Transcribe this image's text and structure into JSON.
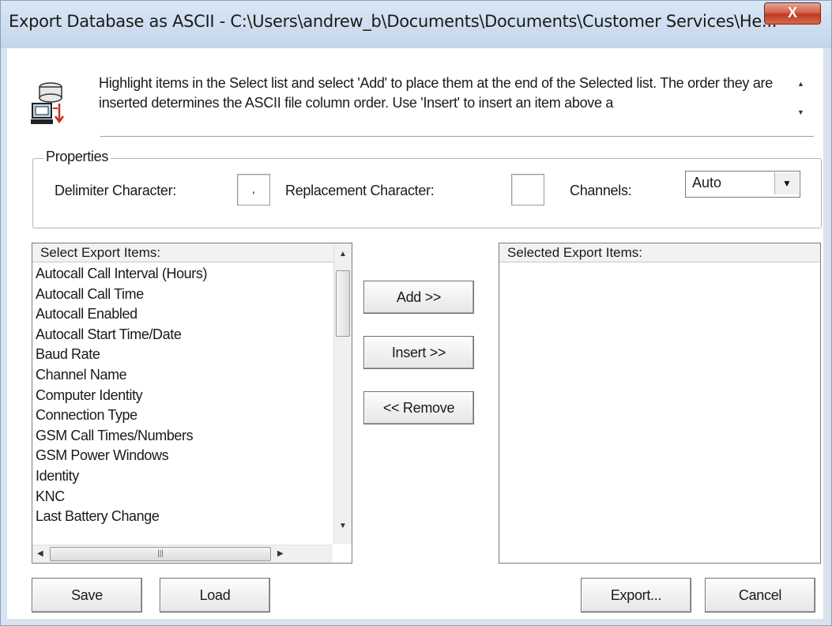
{
  "window": {
    "title": "Export Database as ASCII - C:\\Users\\andrew_b\\Documents\\Documents\\Customer Services\\He...",
    "close_label": "X"
  },
  "info": {
    "text": "Highlight items in the Select list and select 'Add' to place them at the end of the Selected list. The order they are inserted determines the ASCII file column order. Use 'Insert' to insert an item above a"
  },
  "properties": {
    "legend": "Properties",
    "delimiter_label": "Delimiter Character:",
    "delimiter_value": ",",
    "replacement_label": "Replacement Character:",
    "replacement_value": "",
    "channels_label": "Channels:",
    "channels_value": "Auto"
  },
  "select_list": {
    "header": "Select Export Items:",
    "items": [
      "Autocall Call Interval (Hours)",
      "Autocall Call Time",
      "Autocall Enabled",
      "Autocall Start Time/Date",
      "Baud Rate",
      "Channel Name",
      "Computer Identity",
      "Connection Type",
      "GSM Call Times/Numbers",
      "GSM Power Windows",
      "Identity",
      "KNC",
      "Last Battery Change"
    ]
  },
  "selected_list": {
    "header": "Selected Export Items:"
  },
  "buttons": {
    "add": "Add >>",
    "insert": "Insert >>",
    "remove": "<< Remove",
    "save": "Save",
    "load": "Load",
    "export": "Export...",
    "cancel": "Cancel"
  }
}
